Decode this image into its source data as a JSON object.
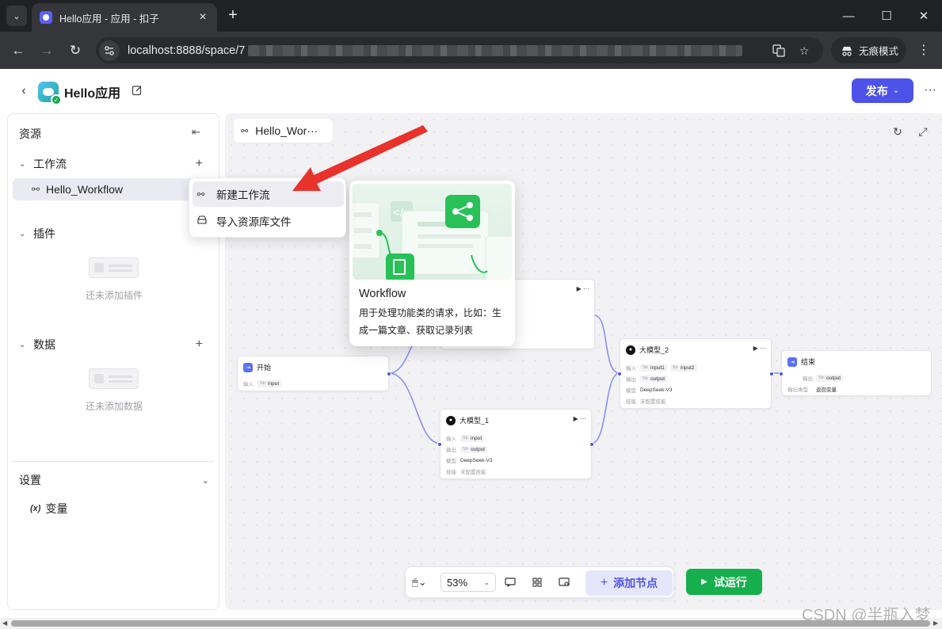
{
  "browser": {
    "tab_title": "Hello应用 - 应用 - 扣子",
    "url_visible": "localhost:8888/space/7",
    "incognito_label": "无痕模式"
  },
  "header": {
    "app_name": "Hello应用",
    "publish_label": "发布"
  },
  "sidebar": {
    "title": "资源",
    "workflow_section": "工作流",
    "workflow_item": "Hello_Workflow",
    "plugin_section": "插件",
    "plugin_empty": "还未添加插件",
    "data_section": "数据",
    "data_empty": "还未添加数据",
    "settings_section": "设置",
    "variable_item": "变量",
    "variable_icon_text": "(x)"
  },
  "menu": {
    "items": [
      {
        "label": "新建工作流",
        "icon": "workflow-icon"
      },
      {
        "label": "导入资源库文件",
        "icon": "import-icon"
      }
    ]
  },
  "preview": {
    "title": "Workflow",
    "description": "用于处理功能类的请求，比如：生成一篇文章、获取记录列表"
  },
  "canvas": {
    "tab_label": "Hello_Wor···",
    "nodes": {
      "start": {
        "title": "开始",
        "input_label": "输入",
        "input_value": "input"
      },
      "llm1": {
        "title": "大模型_1",
        "input_label": "输入",
        "input_value": "input",
        "output_label": "输出",
        "output_value": "output",
        "model_label": "模型",
        "model_value": "DeepSeek-V3",
        "skill_label": "技能",
        "skill_value": "未配置技能"
      },
      "llm2": {
        "title": "大模型_2",
        "input_label": "输入",
        "input_value1": "input1",
        "input_value2": "input2",
        "output_label": "输出",
        "output_value": "output",
        "model_label": "模型",
        "model_value": "DeepSeek-V3",
        "skill_label": "技能",
        "skill_value": "未配置技能"
      },
      "end": {
        "title": "结束",
        "output_label": "输出",
        "output_value": "output",
        "output_type_label": "输出类型",
        "output_type_value": "返回变量"
      }
    },
    "type_tag": "Str"
  },
  "bottom_bar": {
    "zoom": "53%",
    "add_node_label": "添加节点",
    "run_label": "试运行"
  },
  "watermark": "CSDN @半瓶入梦",
  "colors": {
    "primary": "#4d53e8",
    "run_green": "#15b04d",
    "annotation_red": "#e8322b"
  }
}
